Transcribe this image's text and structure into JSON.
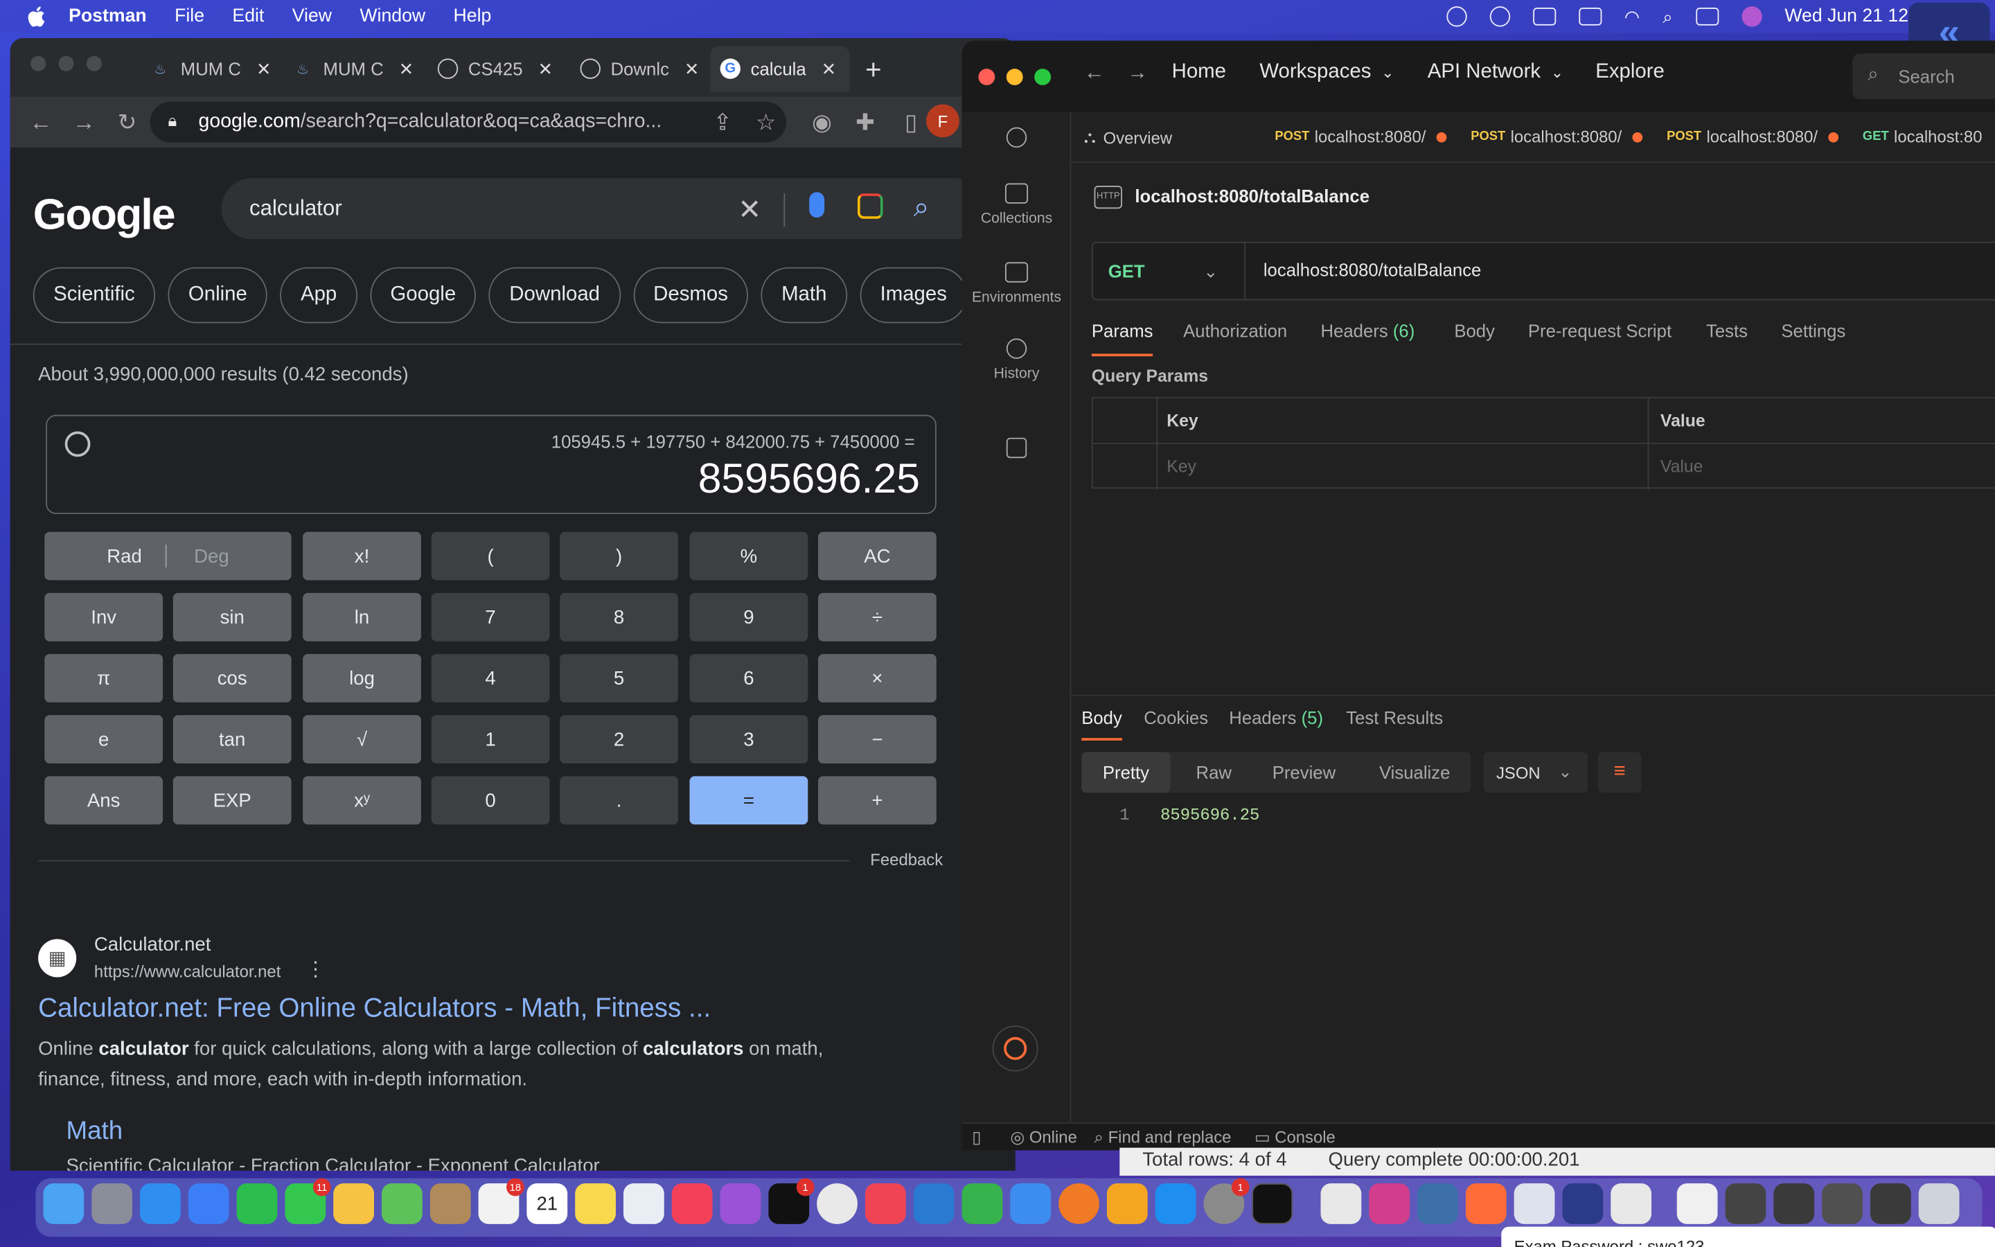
{
  "menubar": {
    "app": "Postman",
    "items": [
      "File",
      "Edit",
      "View",
      "Window",
      "Help"
    ],
    "clock": "Wed Jun 21  12"
  },
  "chrome": {
    "tabs": [
      {
        "label": "MUM C"
      },
      {
        "label": "MUM C"
      },
      {
        "label": "CS425"
      },
      {
        "label": "Downlc"
      },
      {
        "label": "calcula"
      }
    ],
    "address_host": "google.com",
    "address_rest": "/search?q=calculator&oq=ca&aqs=chro...",
    "avatar_letter": "F"
  },
  "google": {
    "logo": "Google",
    "query": "calculator",
    "chips": [
      "Scientific",
      "Online",
      "App",
      "Google",
      "Download",
      "Desmos",
      "Math",
      "Images"
    ],
    "stats": "About 3,990,000,000 results (0.42 seconds)",
    "calc": {
      "expression": "105945.5 + 197750 + 842000.75 + 7450000 =",
      "result": "8595696.25",
      "rad": "Rad",
      "deg": "Deg",
      "keys": [
        "x!",
        "(",
        ")",
        "%",
        "AC",
        "Inv",
        "sin",
        "ln",
        "7",
        "8",
        "9",
        "÷",
        "π",
        "cos",
        "log",
        "4",
        "5",
        "6",
        "×",
        "e",
        "tan",
        "√",
        "1",
        "2",
        "3",
        "−",
        "Ans",
        "EXP",
        "xʸ",
        "0",
        ".",
        "=",
        "+"
      ]
    },
    "feedback": "Feedback",
    "result": {
      "site": "Calculator.net",
      "url": "https://www.calculator.net",
      "title": "Calculator.net: Free Online Calculators - Math, Fitness ...",
      "snippet_pre": "Online ",
      "snippet_b1": "calculator",
      "snippet_mid": " for quick calculations, along with a large collection of ",
      "snippet_b2": "calculators",
      "snippet_post": " on math, finance, fitness, and more, each with in-depth information.",
      "sublink": "Math",
      "sublink_desc": "Scientific Calculator - Fraction Calculator - Exponent Calculator"
    }
  },
  "postman": {
    "nav": [
      "Home",
      "Workspaces",
      "API Network",
      "Explore"
    ],
    "search": "Search",
    "sidebar": [
      "Collections",
      "Environments",
      "History"
    ],
    "tabs": [
      {
        "label": "Overview"
      },
      {
        "method": "POST",
        "label": "localhost:8080/"
      },
      {
        "method": "POST",
        "label": "localhost:8080/"
      },
      {
        "method": "POST",
        "label": "localhost:8080/"
      },
      {
        "method": "GET",
        "label": "localhost:80"
      }
    ],
    "request_title": "localhost:8080/totalBalance",
    "method": "GET",
    "url": "localhost:8080/totalBalance",
    "req_tabs": [
      "Params",
      "Authorization",
      "Headers",
      "Body",
      "Pre-request Script",
      "Tests",
      "Settings"
    ],
    "req_headers_count": "(6)",
    "query_params_label": "Query Params",
    "table": {
      "key_header": "Key",
      "value_header": "Value",
      "key_placeholder": "Key",
      "value_placeholder": "Value"
    },
    "resp_tabs": [
      "Body",
      "Cookies",
      "Headers",
      "Test Results"
    ],
    "resp_headers_count": "(5)",
    "formats": [
      "Pretty",
      "Raw",
      "Preview",
      "Visualize"
    ],
    "format_type": "JSON",
    "response_line_no": "1",
    "response_value": "8595696.25",
    "status": {
      "online": "Online",
      "find": "Find and replace",
      "console": "Console"
    }
  },
  "behind": {
    "rows": "Total rows: 4 of 4",
    "query": "Query complete 00:00:00.201"
  },
  "exam": "Exam Password : swe123",
  "dock_badges": {
    "messages": "11",
    "reminders": "18",
    "tv": "1",
    "settings": "1"
  },
  "calendar_day": "21"
}
